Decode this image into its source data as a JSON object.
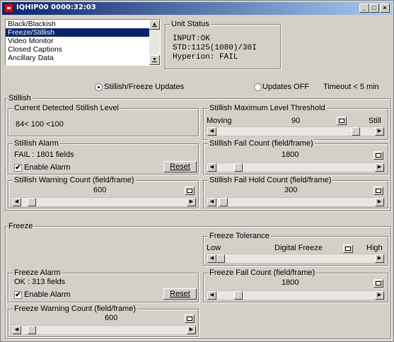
{
  "window": {
    "title": "IQHIP00 0000:32:03",
    "min": "_",
    "max": "□",
    "close": "×"
  },
  "listbox": {
    "items": [
      "Black/Blackish",
      "Freeze/Stillish",
      "Video Monitor",
      "Closed Captions",
      "Ancillary Data"
    ],
    "selected_index": 1
  },
  "unit_status": {
    "title": "Unit Status",
    "lines": [
      "INPUT:OK",
      "STD:1125(1080)/30I",
      "Hyperion: FAIL"
    ]
  },
  "updates": {
    "stillish_label": "Stillish/Freeze Updates",
    "off_label": "Updates OFF",
    "timeout": "Timeout < 5 min",
    "selected": "stillish"
  },
  "stillish": {
    "title": "Stillish",
    "current_level": {
      "title": "Current Detected Stillish Level",
      "value": "84< 100 <100"
    },
    "max_threshold": {
      "title": "Stillish  Maximum Level Threshold",
      "low": "Moving",
      "value": "90",
      "high": "Still",
      "level_fraction": 0.9
    },
    "alarm": {
      "title": "Stillish Alarm",
      "status": "FAIL : 1801 fields",
      "enable_label": "Enable Alarm",
      "enabled": true,
      "reset_label": "Reset"
    },
    "fail_count": {
      "title": "Stillish Fail Count (field/frame)",
      "value": "1800",
      "level_fraction": 0.12
    },
    "warning_count": {
      "title": "Stillish Warning Count (field/frame)",
      "value": "600",
      "level_fraction": 0.04
    },
    "fail_hold": {
      "title": "Stillish Fail Hold Count (field/frame)",
      "value": "300",
      "level_fraction": 0.02
    }
  },
  "freeze": {
    "title": "Freeze",
    "tolerance": {
      "title": "Freeze Tolerance",
      "low": "Low",
      "mid": "Digital Freeze",
      "high": "High",
      "level_fraction": 0.0
    },
    "alarm": {
      "title": "Freeze Alarm",
      "status": "OK : 313 fields",
      "enable_label": "Enable Alarm",
      "enabled": true,
      "reset_label": "Reset"
    },
    "fail_count": {
      "title": "Freeze Fail Count (field/frame)",
      "value": "1800",
      "level_fraction": 0.12
    },
    "warning_count": {
      "title": "Freeze Warning Count (field/frame)",
      "value": "600",
      "level_fraction": 0.04
    }
  },
  "glyphs": {
    "check": "✔",
    "left": "◀",
    "right": "▶",
    "up": "▲",
    "down": "▼"
  },
  "colors": {
    "title_start": "#0a246a",
    "title_end": "#a6caf0",
    "face": "#d4d0c8",
    "selection": "#0a246a"
  }
}
